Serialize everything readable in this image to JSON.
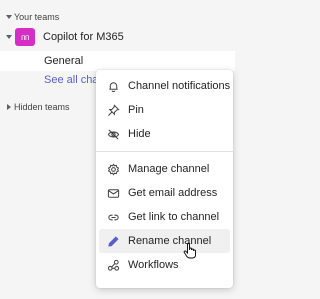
{
  "sidebar": {
    "your_teams_label": "Your teams",
    "team": {
      "avatar_initials": "ᴨᴨ",
      "avatar_color": "#d62ec4",
      "name": "Copilot for M365"
    },
    "channel": {
      "name": "General"
    },
    "see_all": "See all chan",
    "hidden_teams_label": "Hidden teams"
  },
  "context_menu": {
    "items": [
      {
        "label": "Channel notifications",
        "icon": "bell-icon"
      },
      {
        "label": "Pin",
        "icon": "pin-icon"
      },
      {
        "label": "Hide",
        "icon": "eye-off-icon"
      },
      {
        "label": "Manage channel",
        "icon": "gear-icon"
      },
      {
        "label": "Get email address",
        "icon": "mail-icon"
      },
      {
        "label": "Get link to channel",
        "icon": "link-icon"
      },
      {
        "label": "Rename channel",
        "icon": "pencil-icon",
        "hovered": true
      },
      {
        "label": "Workflows",
        "icon": "workflows-icon"
      }
    ]
  },
  "colors": {
    "accent": "#5b5fc7",
    "pencil": "#5b5fc7"
  }
}
